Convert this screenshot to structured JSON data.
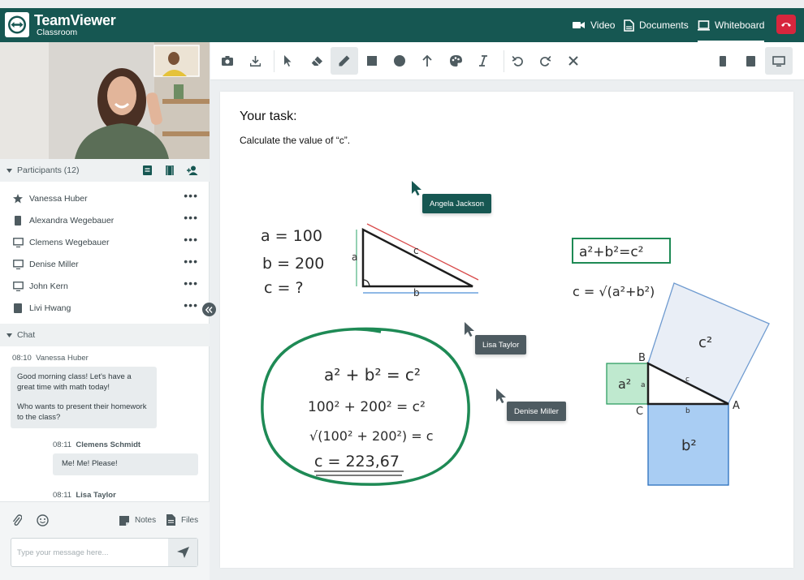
{
  "header": {
    "brand": "TeamViewer",
    "brand_sub": "Classroom",
    "nav": [
      {
        "label": "Video"
      },
      {
        "label": "Documents"
      },
      {
        "label": "Whiteboard"
      }
    ]
  },
  "participants": {
    "title": "Participants (12)",
    "list": [
      {
        "name": "Vanessa Huber",
        "icon": "star-icon"
      },
      {
        "name": "Alexandra Wegebauer",
        "icon": "phone-icon"
      },
      {
        "name": "Clemens Wegebauer",
        "icon": "monitor-icon"
      },
      {
        "name": "Denise Miller",
        "icon": "monitor-icon"
      },
      {
        "name": "John Kern",
        "icon": "monitor-icon"
      },
      {
        "name": "Livi Hwang",
        "icon": "tablet-icon"
      }
    ]
  },
  "chat": {
    "title": "Chat",
    "messages": [
      {
        "time": "08:10",
        "author": "Vanessa Huber",
        "lines": [
          "Good morning class! Let's have a",
          "great time with math today!",
          "",
          "Who wants to present their homework",
          "to the class?"
        ]
      },
      {
        "time": "08:11",
        "author": "Clemens Schmidt",
        "lines": [
          "Me! Me! Please!"
        ]
      },
      {
        "time": "08:11",
        "author": "Lisa Taylor",
        "lines": []
      }
    ],
    "notes_label": "Notes",
    "files_label": "Files",
    "input_placeholder": "Type your message here..."
  },
  "whiteboard": {
    "task_title": "Your task:",
    "task_text": "Calculate the value of “c”.",
    "cursors": [
      {
        "name": "Angela Jackson",
        "color": "#165752"
      },
      {
        "name": "Lisa Taylor",
        "color": "#4e5b61"
      },
      {
        "name": "Denise Miller",
        "color": "#4e5b61"
      }
    ],
    "givens": [
      "a = 100",
      "b = 200",
      "c = ?"
    ],
    "triangle_labels": {
      "a": "a",
      "b": "b",
      "c": "c"
    },
    "formula_box": "a²+b²=c²",
    "formula_root": "c = √(a²+b²)",
    "solution": [
      "a² + b² = c²",
      "100² + 200² = c²",
      "√(100² + 200²) = c",
      "c = 223,67"
    ],
    "squares": {
      "a2": "a²",
      "b2": "b²",
      "c2": "c²",
      "side_a": "a",
      "side_b": "b",
      "side_c": "c",
      "vA": "A",
      "vB": "B",
      "vC": "C"
    }
  },
  "colors": {
    "brand": "#165752",
    "end_call": "#d7263d",
    "circle": "#1e8a55",
    "square_a": "#bfe9cf",
    "square_b": "#a9cdf3",
    "square_c": "#e9eef6"
  }
}
